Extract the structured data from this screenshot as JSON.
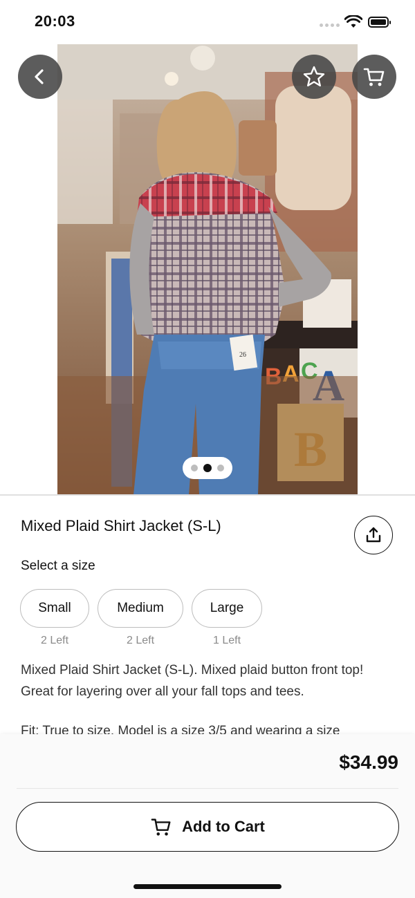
{
  "status_bar": {
    "time": "20:03"
  },
  "nav": {
    "back_icon": "chevron-left-icon",
    "favorite_icon": "star-outline-icon",
    "cart_icon": "cart-icon"
  },
  "gallery": {
    "image_count": 3,
    "active_index": 1
  },
  "product": {
    "title": "Mixed Plaid Shirt Jacket (S-L)",
    "share_icon": "share-upload-icon",
    "size_prompt": "Select a size",
    "sizes": [
      {
        "label": "Small",
        "stock": "2 Left"
      },
      {
        "label": "Medium",
        "stock": "2 Left"
      },
      {
        "label": "Large",
        "stock": "1 Left"
      }
    ],
    "description": [
      "Mixed Plaid Shirt Jacket (S-L). Mixed plaid button front top! Great for layering over all your fall tops and tees.",
      "Fit: True to size. Model is a size 3/5 and wearing a size"
    ]
  },
  "checkout": {
    "price": "$34.99",
    "add_to_cart_label": "Add to Cart"
  },
  "colors": {
    "overlay_button": "#464646",
    "accent": "#111111"
  }
}
